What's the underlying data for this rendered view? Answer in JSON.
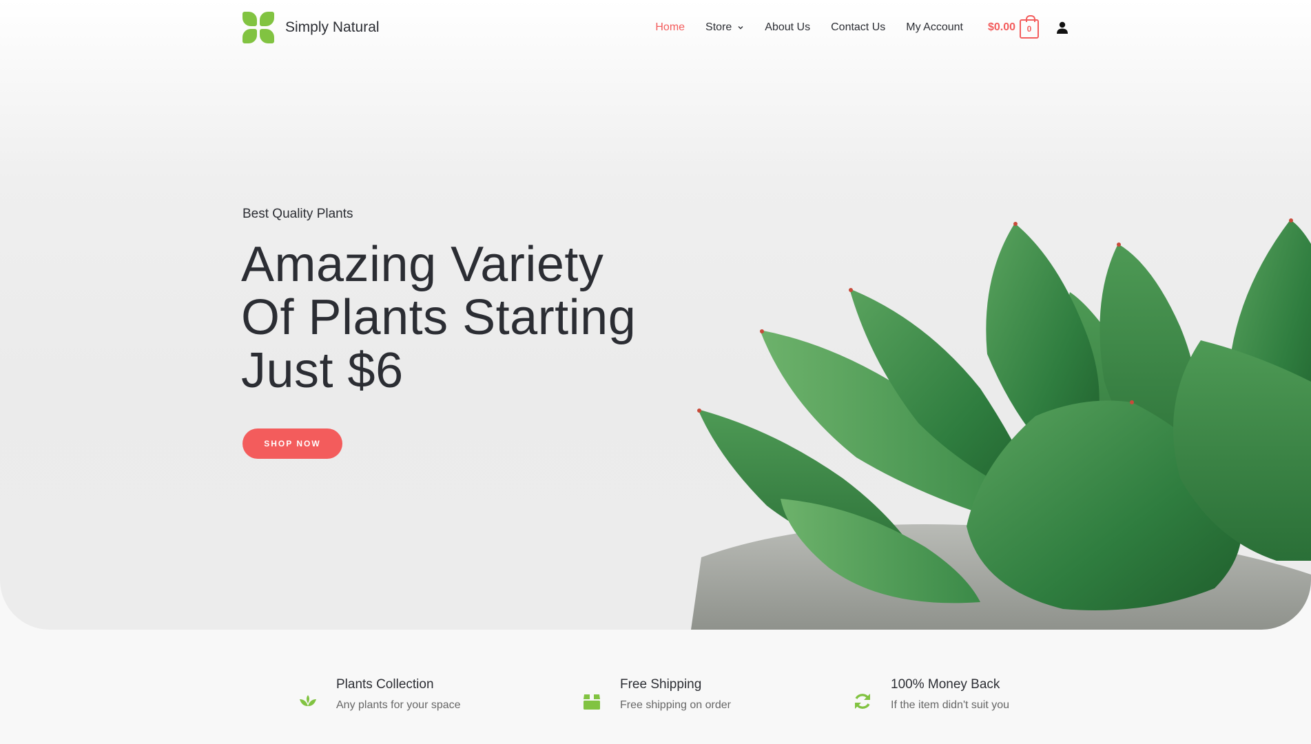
{
  "header": {
    "logo_text": "Simply Natural",
    "nav": [
      {
        "label": "Home",
        "active": true
      },
      {
        "label": "Store",
        "dropdown": true
      },
      {
        "label": "About Us"
      },
      {
        "label": "Contact Us"
      },
      {
        "label": "My Account"
      }
    ],
    "cart_total": "$0.00",
    "cart_count": "0"
  },
  "hero": {
    "subtitle": "Best Quality Plants",
    "title_lines": [
      "Amazing Variety",
      "Of Plants Starting",
      "Just $6"
    ],
    "cta_label": "SHOP NOW"
  },
  "features": [
    {
      "icon": "lotus-icon",
      "title": "Plants Collection",
      "text": "Any plants for your space"
    },
    {
      "icon": "box-icon",
      "title": "Free Shipping",
      "text": "Free shipping on order"
    },
    {
      "icon": "refresh-icon",
      "title": "100% Money Back",
      "text": "If the item didn't suit you"
    }
  ],
  "colors": {
    "accent": "#f35c5c",
    "brand_green": "#81c341",
    "text": "#2b2d33",
    "muted": "#666666"
  }
}
